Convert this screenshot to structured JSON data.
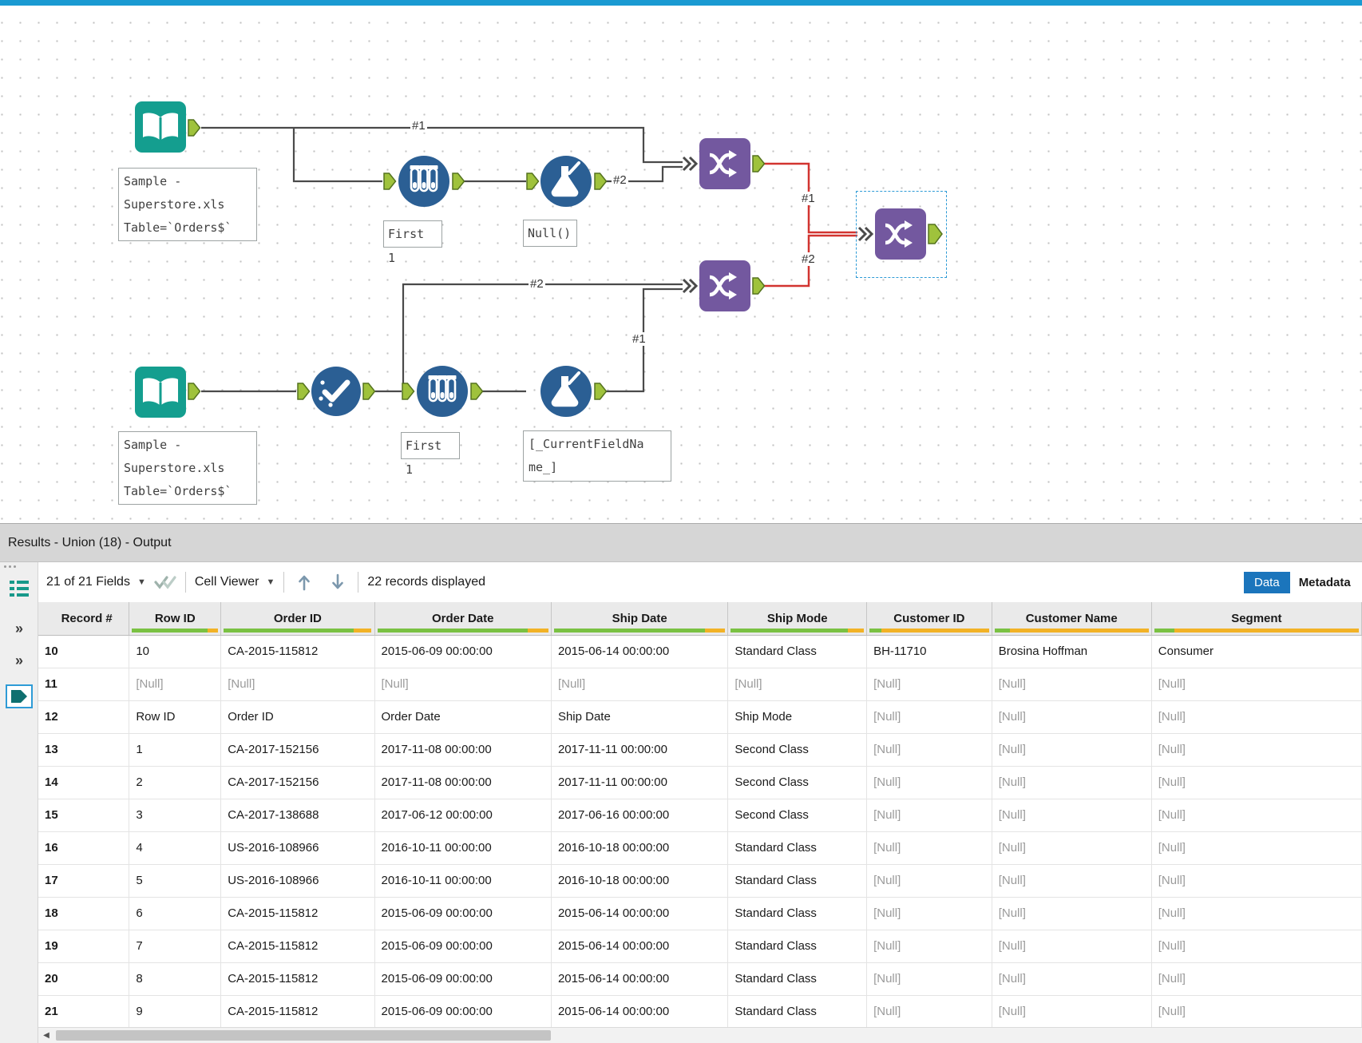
{
  "canvas": {
    "annotations": {
      "input1": "Sample -\nSuperstore.xls\nTable=`Orders$`",
      "input2": "Sample -\nSuperstore.xls\nTable=`Orders$`",
      "sample1": "First 1",
      "sample2": "First 1",
      "formula1": "Null()",
      "formula2": "[_CurrentFieldNa\nme_]"
    },
    "connection_labels": {
      "union1_in1": "#1",
      "union1_in2": "#2",
      "union2_in1": "#1",
      "union2_in2": "#2",
      "final_in1": "#1",
      "final_in2": "#2"
    },
    "icons": {
      "input_data": "book-icon",
      "sample": "test-tubes-icon",
      "formula": "flask-icon",
      "unique": "check-icon",
      "union": "merge-strands-icon"
    },
    "colors": {
      "input_teal": "#149E8F",
      "prep_blue": "#2B5F94",
      "union_purple": "#73589F",
      "anchor_green": "#9FC23C",
      "wire_gray": "#4A4A4A",
      "wire_red": "#D23430",
      "selection_blue": "#2E9BD6"
    }
  },
  "results": {
    "title": "Results - Union (18) - Output",
    "toolbar": {
      "fields": "21 of 21 Fields",
      "cell_viewer": "Cell Viewer",
      "records": "22 records displayed",
      "tabs": {
        "data": "Data",
        "metadata": "Metadata"
      }
    },
    "table": {
      "row_header": "Record #",
      "columns": [
        {
          "label": "Row ID",
          "green": 0.88,
          "yellow": 0.12
        },
        {
          "label": "Order ID",
          "green": 0.88,
          "yellow": 0.12
        },
        {
          "label": "Order Date",
          "green": 0.88,
          "yellow": 0.12
        },
        {
          "label": "Ship Date",
          "green": 0.88,
          "yellow": 0.12
        },
        {
          "label": "Ship Mode",
          "green": 0.88,
          "yellow": 0.12
        },
        {
          "label": "Customer ID",
          "green": 0.1,
          "yellow": 0.9
        },
        {
          "label": "Customer Name",
          "green": 0.1,
          "yellow": 0.9
        },
        {
          "label": "Segment",
          "green": 0.1,
          "yellow": 0.9
        }
      ],
      "rows": [
        {
          "num": "10",
          "cells": [
            "10",
            "CA-2015-115812",
            "2015-06-09 00:00:00",
            "2015-06-14 00:00:00",
            "Standard Class",
            "BH-11710",
            "Brosina Hoffman",
            "Consumer"
          ]
        },
        {
          "num": "11",
          "cells": [
            "[Null]",
            "[Null]",
            "[Null]",
            "[Null]",
            "[Null]",
            "[Null]",
            "[Null]",
            "[Null]"
          ]
        },
        {
          "num": "12",
          "cells": [
            "Row ID",
            "Order ID",
            "Order Date",
            "Ship Date",
            "Ship Mode",
            "[Null]",
            "[Null]",
            "[Null]"
          ]
        },
        {
          "num": "13",
          "cells": [
            "1",
            "CA-2017-152156",
            "2017-11-08 00:00:00",
            "2017-11-11 00:00:00",
            "Second Class",
            "[Null]",
            "[Null]",
            "[Null]"
          ]
        },
        {
          "num": "14",
          "cells": [
            "2",
            "CA-2017-152156",
            "2017-11-08 00:00:00",
            "2017-11-11 00:00:00",
            "Second Class",
            "[Null]",
            "[Null]",
            "[Null]"
          ]
        },
        {
          "num": "15",
          "cells": [
            "3",
            "CA-2017-138688",
            "2017-06-12 00:00:00",
            "2017-06-16 00:00:00",
            "Second Class",
            "[Null]",
            "[Null]",
            "[Null]"
          ]
        },
        {
          "num": "16",
          "cells": [
            "4",
            "US-2016-108966",
            "2016-10-11 00:00:00",
            "2016-10-18 00:00:00",
            "Standard Class",
            "[Null]",
            "[Null]",
            "[Null]"
          ]
        },
        {
          "num": "17",
          "cells": [
            "5",
            "US-2016-108966",
            "2016-10-11 00:00:00",
            "2016-10-18 00:00:00",
            "Standard Class",
            "[Null]",
            "[Null]",
            "[Null]"
          ]
        },
        {
          "num": "18",
          "cells": [
            "6",
            "CA-2015-115812",
            "2015-06-09 00:00:00",
            "2015-06-14 00:00:00",
            "Standard Class",
            "[Null]",
            "[Null]",
            "[Null]"
          ]
        },
        {
          "num": "19",
          "cells": [
            "7",
            "CA-2015-115812",
            "2015-06-09 00:00:00",
            "2015-06-14 00:00:00",
            "Standard Class",
            "[Null]",
            "[Null]",
            "[Null]"
          ]
        },
        {
          "num": "20",
          "cells": [
            "8",
            "CA-2015-115812",
            "2015-06-09 00:00:00",
            "2015-06-14 00:00:00",
            "Standard Class",
            "[Null]",
            "[Null]",
            "[Null]"
          ]
        },
        {
          "num": "21",
          "cells": [
            "9",
            "CA-2015-115812",
            "2015-06-09 00:00:00",
            "2015-06-14 00:00:00",
            "Standard Class",
            "[Null]",
            "[Null]",
            "[Null]"
          ]
        }
      ]
    }
  }
}
